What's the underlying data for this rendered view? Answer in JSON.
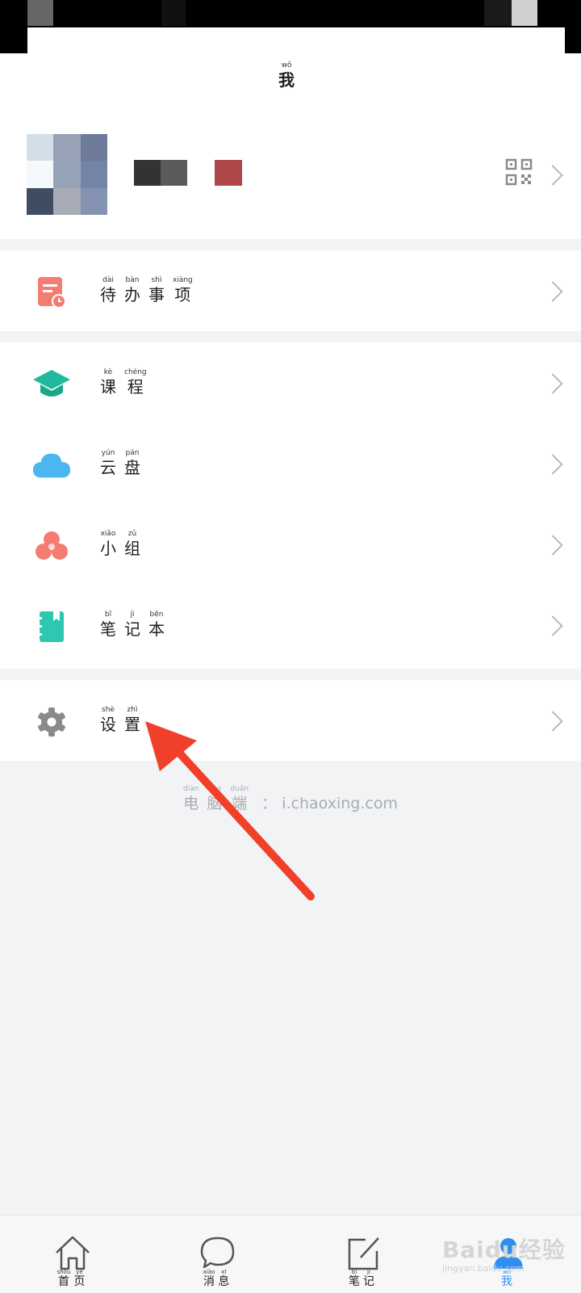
{
  "header": {
    "title": {
      "py": "wǒ",
      "hz": "我"
    }
  },
  "profile": {
    "avatar_colors": [
      "#d4dee6",
      "#97a2b6",
      "#6d7a99",
      "#f6f9fc",
      "#97a3b9",
      "#7484a4",
      "#3f4c62",
      "#a7acb6",
      "#8393b1"
    ],
    "name_colors": [
      "#333333",
      "#5a5a5a",
      "#b0474a"
    ]
  },
  "menu": {
    "todo": {
      "labels": [
        {
          "py": "dài",
          "hz": "待"
        },
        {
          "py": "bàn",
          "hz": "办"
        },
        {
          "py": "shì",
          "hz": "事"
        },
        {
          "py": "xiàng",
          "hz": "项"
        }
      ],
      "icon": "todo-document-icon",
      "color": "#f47c72"
    },
    "course": {
      "labels": [
        {
          "py": "kè",
          "hz": "课"
        },
        {
          "py": "chéng",
          "hz": "程"
        }
      ],
      "icon": "graduation-cap-icon",
      "color": "#22b89b"
    },
    "cloud": {
      "labels": [
        {
          "py": "yún",
          "hz": "云"
        },
        {
          "py": "pán",
          "hz": "盘"
        }
      ],
      "icon": "cloud-icon",
      "color": "#4ab7f3"
    },
    "group": {
      "labels": [
        {
          "py": "xiǎo",
          "hz": "小"
        },
        {
          "py": "zǔ",
          "hz": "组"
        }
      ],
      "icon": "group-circles-icon",
      "color": "#f47c72"
    },
    "notebook": {
      "labels": [
        {
          "py": "bǐ",
          "hz": "笔"
        },
        {
          "py": "jì",
          "hz": "记"
        },
        {
          "py": "běn",
          "hz": "本"
        }
      ],
      "icon": "notebook-icon",
      "color": "#2ec7b1"
    },
    "settings": {
      "labels": [
        {
          "py": "shè",
          "hz": "设"
        },
        {
          "py": "zhì",
          "hz": "置"
        }
      ],
      "icon": "gear-icon",
      "color": "#8a8a8a"
    }
  },
  "footer_note": {
    "labels": [
      {
        "py": "diàn",
        "hz": "电"
      },
      {
        "py": "nǎo",
        "hz": "脑"
      },
      {
        "py": "duān",
        "hz": "端"
      }
    ],
    "sep": "：",
    "url": "i.chaoxing.com"
  },
  "tabbar": {
    "tabs": [
      {
        "labels": [
          {
            "py": "shǒu",
            "hz": "首"
          },
          {
            "py": "yè",
            "hz": "页"
          }
        ]
      },
      {
        "labels": [
          {
            "py": "xiāo",
            "hz": "消"
          },
          {
            "py": "xī",
            "hz": "息"
          }
        ]
      },
      {
        "labels": [
          {
            "py": "bǐ",
            "hz": "笔"
          },
          {
            "py": "jì",
            "hz": "记"
          }
        ]
      },
      {
        "labels": [
          {
            "py": "wǒ",
            "hz": "我"
          }
        ]
      }
    ],
    "active_color": "#2f8ff0",
    "inactive_color": "#555555"
  },
  "watermark": {
    "brand": "Baidu经验",
    "sub": "jingyan.baidu.com"
  }
}
